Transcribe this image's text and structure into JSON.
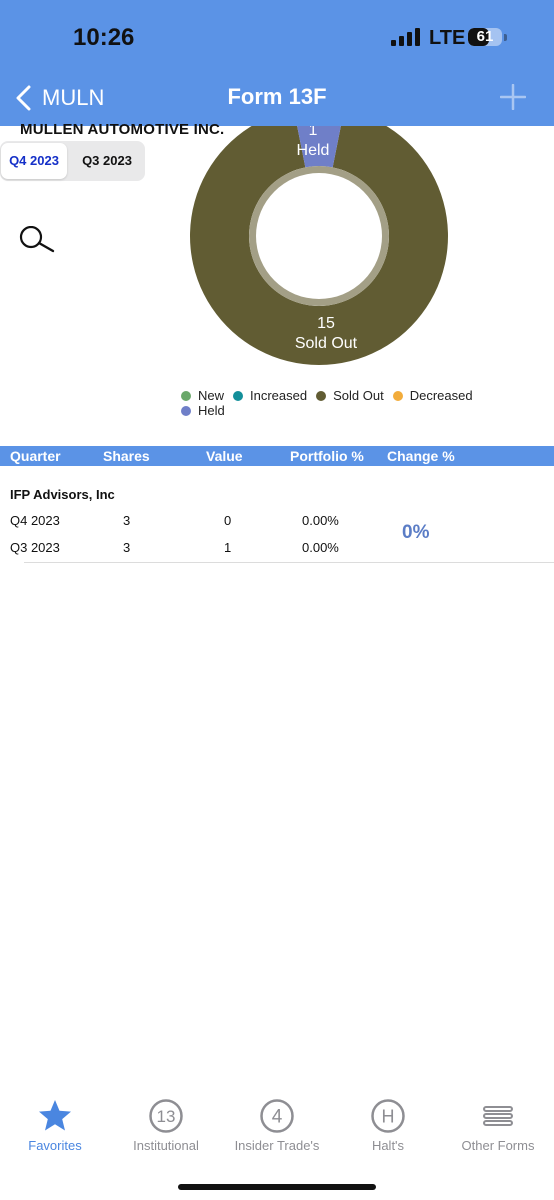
{
  "status_bar": {
    "time": "10:26",
    "network": "LTE",
    "battery": "61",
    "battery_level": 0.61
  },
  "nav": {
    "back_label": "MULN",
    "title": "Form 13F"
  },
  "company": {
    "name": "MULLEN AUTOMOTIVE INC."
  },
  "quarters": {
    "active": "Q4 2023",
    "inactive": "Q3 2023"
  },
  "chart_data": {
    "type": "pie",
    "slices": [
      {
        "label": "Sold Out",
        "value": 15,
        "color": "#615c33"
      },
      {
        "label": "Held",
        "value": 1,
        "color": "#6f7fc8"
      }
    ],
    "legend": [
      {
        "label": "New",
        "color": "#6aa86a"
      },
      {
        "label": "Increased",
        "color": "#138f9a"
      },
      {
        "label": "Sold Out",
        "color": "#615c33"
      },
      {
        "label": "Decreased",
        "color": "#f2ac3b"
      },
      {
        "label": "Held",
        "color": "#6f7fc8"
      }
    ]
  },
  "table": {
    "headers": [
      "Quarter",
      "Shares",
      "Value",
      "Portfolio %",
      "Change %"
    ],
    "advisor": "IFP Advisors, Inc",
    "rows": [
      {
        "quarter": "Q4 2023",
        "shares": "3",
        "value": "0",
        "portfolio": "0.00%"
      },
      {
        "quarter": "Q3 2023",
        "shares": "3",
        "value": "1",
        "portfolio": "0.00%"
      }
    ],
    "change": "0%"
  },
  "tabs": [
    {
      "label": "Favorites",
      "icon": "star-icon",
      "glyph": ""
    },
    {
      "label": "Institutional",
      "icon": "circle-13-icon",
      "glyph": "13"
    },
    {
      "label": "Insider Trade's",
      "icon": "circle-4-icon",
      "glyph": "4"
    },
    {
      "label": "Halt's",
      "icon": "circle-h-icon",
      "glyph": "H"
    },
    {
      "label": "Other Forms",
      "icon": "stack-lines-icon",
      "glyph": ""
    }
  ],
  "colors": {
    "accent": "#5b93e6",
    "active_tab": "#4a86e0",
    "inactive_tab": "#8e8e93"
  }
}
